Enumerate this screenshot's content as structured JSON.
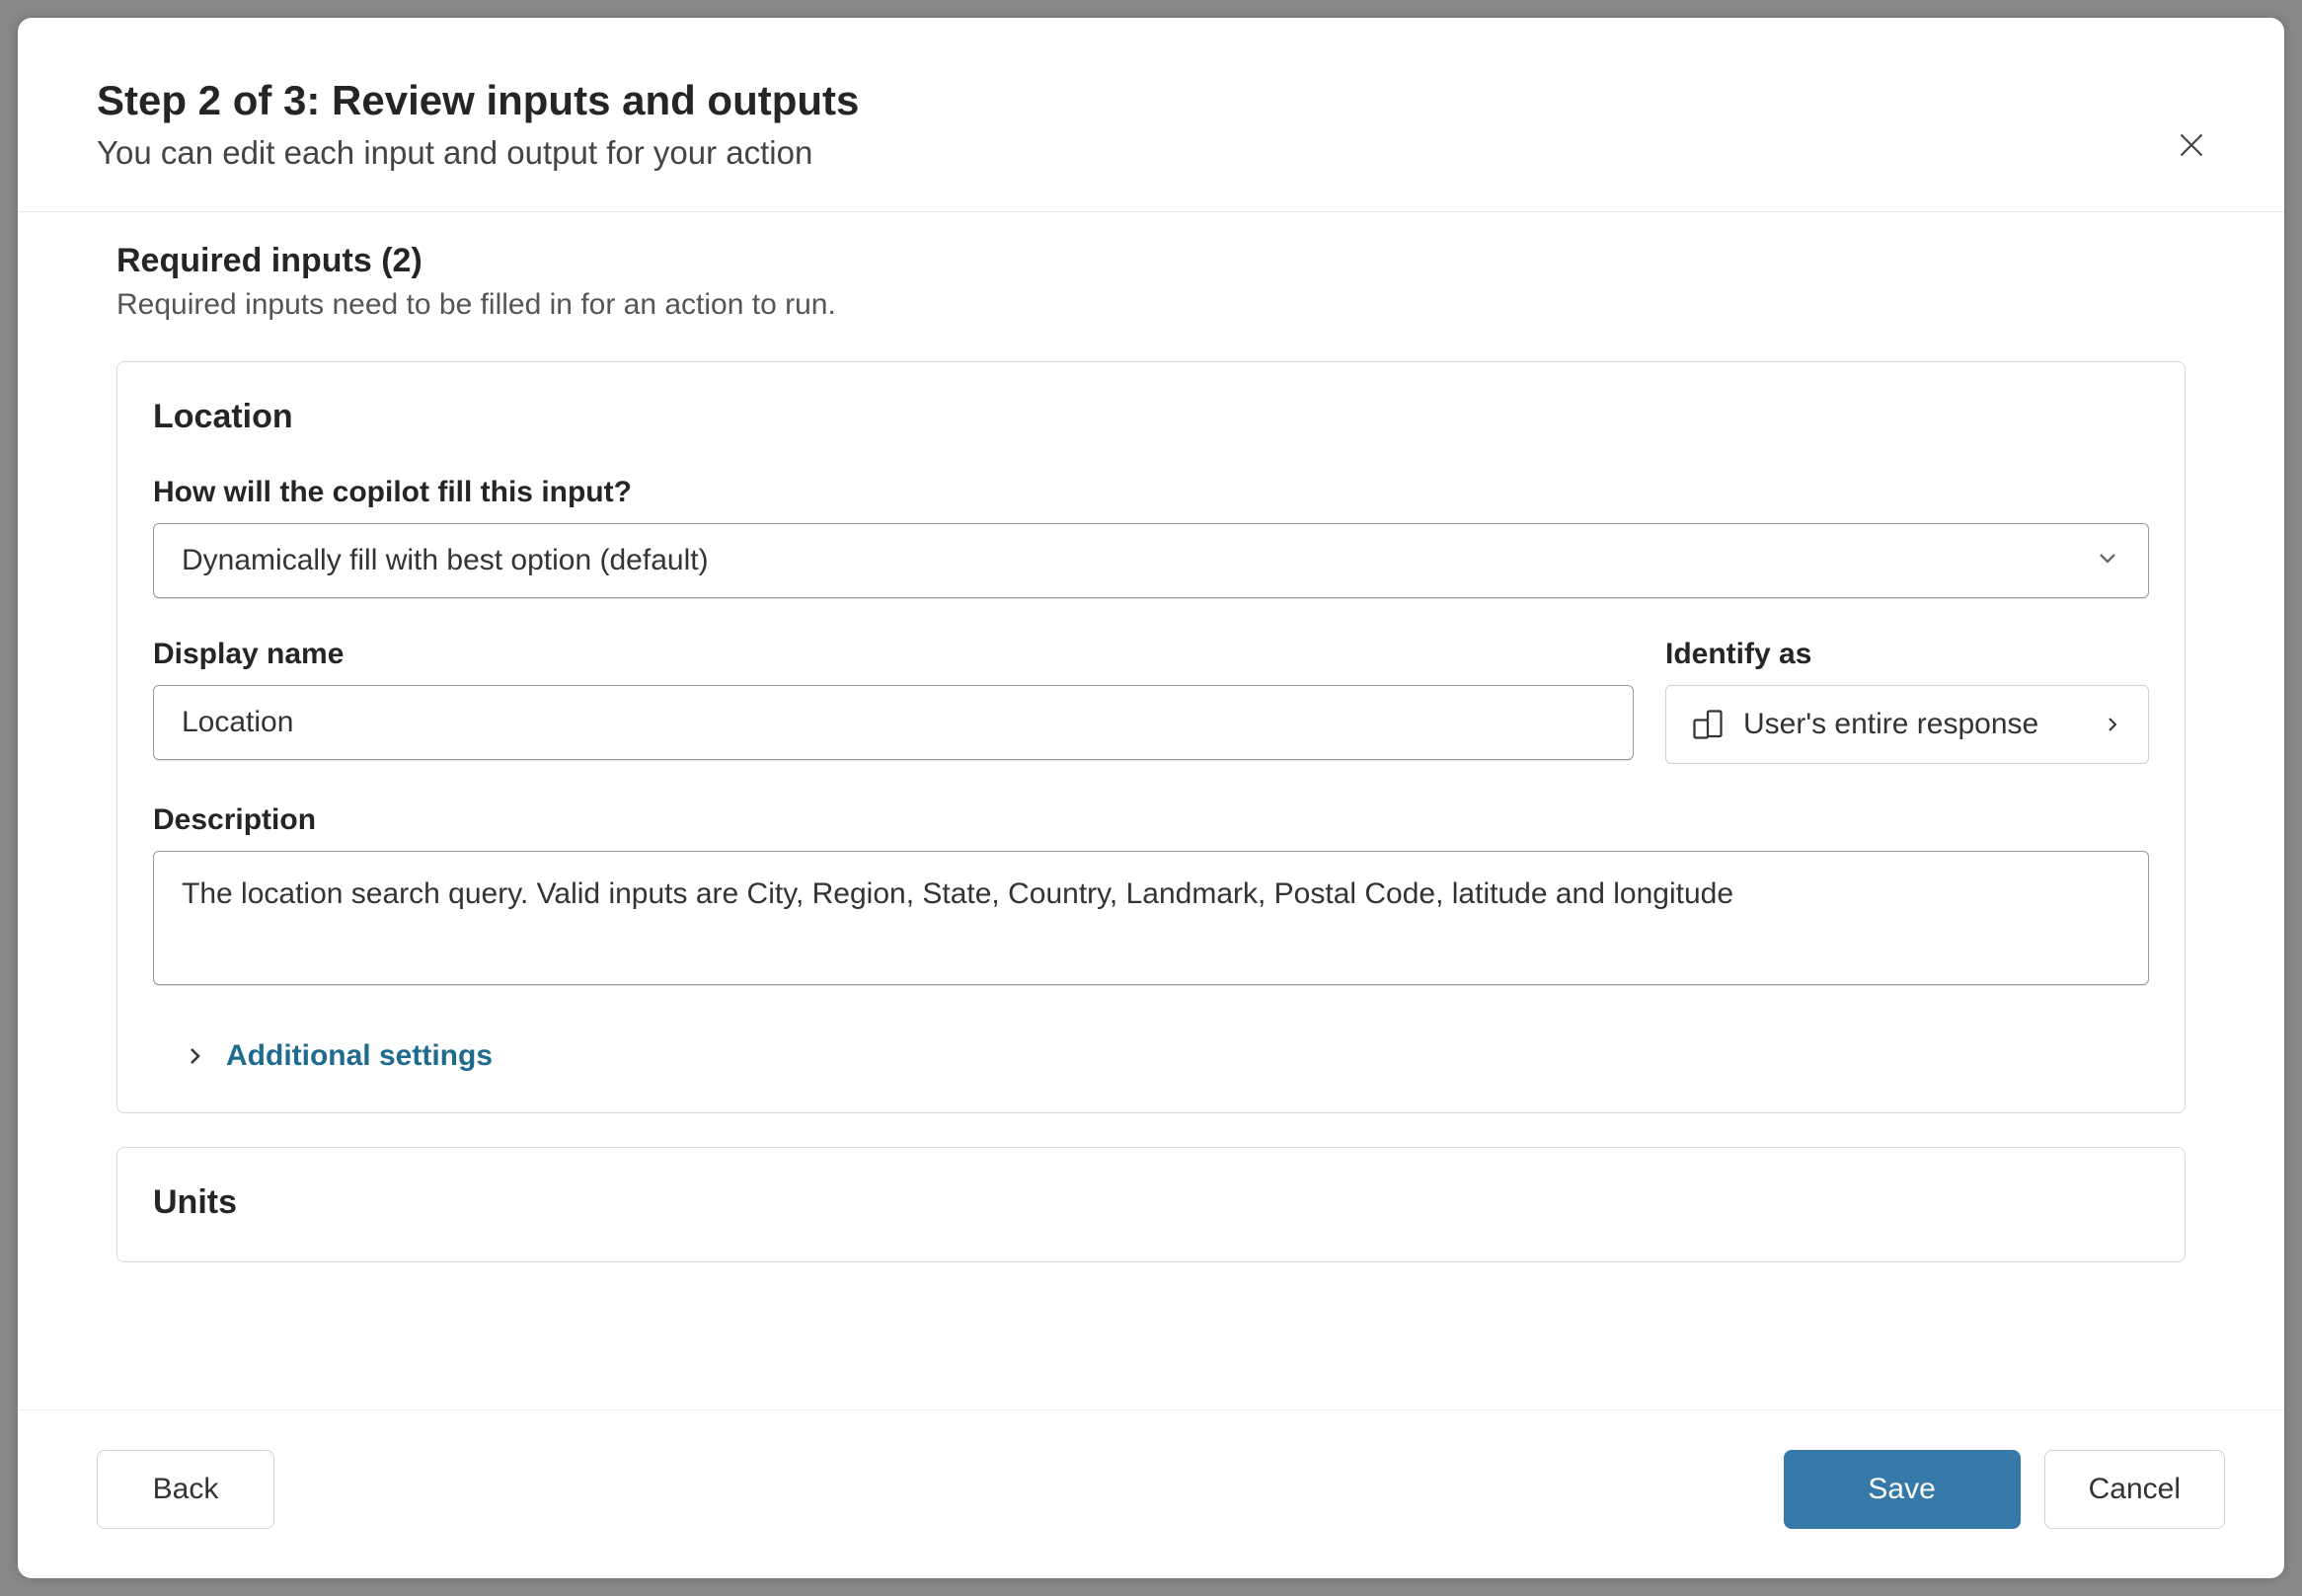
{
  "header": {
    "title": "Step 2 of 3: Review inputs and outputs",
    "subtitle": "You can edit each input and output for your action"
  },
  "requiredInputs": {
    "title": "Required inputs (2)",
    "subtitle": "Required inputs need to be filled in for an action to run."
  },
  "cards": [
    {
      "title": "Location",
      "fillLabel": "How will the copilot fill this input?",
      "fillValue": "Dynamically fill with best option (default)",
      "displayNameLabel": "Display name",
      "displayNameValue": "Location",
      "identifyLabel": "Identify as",
      "identifyValue": "User's entire response",
      "descriptionLabel": "Description",
      "descriptionValue": "The location search query. Valid inputs are City, Region, State, Country, Landmark, Postal Code, latitude and longitude",
      "additionalSettings": "Additional settings"
    },
    {
      "title": "Units"
    }
  ],
  "footer": {
    "back": "Back",
    "save": "Save",
    "cancel": "Cancel"
  }
}
